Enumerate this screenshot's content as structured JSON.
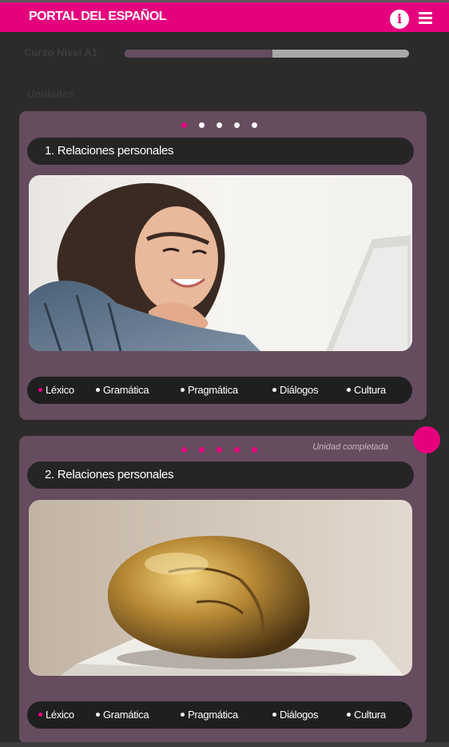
{
  "header": {
    "brand": "PORTAL DEL ESPAÑOL",
    "info_icon": "info-icon",
    "menu_icon": "hamburger-menu-icon",
    "accent_color": "#e6007e"
  },
  "course": {
    "label": "Curso Nivel A1",
    "progress_fraction": 0.52
  },
  "units_section": {
    "title": "Unidades"
  },
  "units": [
    {
      "title": "1. Relaciones personales",
      "dots_total": 5,
      "dots_active_index": 0,
      "completed": false,
      "image_icon": "woman-laptop-photo",
      "topics": [
        {
          "label": "Léxico",
          "active": true
        },
        {
          "label": "Gramática",
          "active": false
        },
        {
          "label": "Pragmática",
          "active": false
        },
        {
          "label": "Diálogos",
          "active": false
        },
        {
          "label": "Cultura",
          "active": false
        }
      ]
    },
    {
      "title": "2. Relaciones personales",
      "dots_total": 5,
      "completed": true,
      "completed_label": "Unidad completada",
      "image_icon": "bronze-sculpture-photo",
      "topics": [
        {
          "label": "Léxico",
          "active": true
        },
        {
          "label": "Gramática",
          "active": false
        },
        {
          "label": "Pragmática",
          "active": false
        },
        {
          "label": "Diálogos",
          "active": false
        },
        {
          "label": "Cultura",
          "active": false
        }
      ]
    }
  ]
}
